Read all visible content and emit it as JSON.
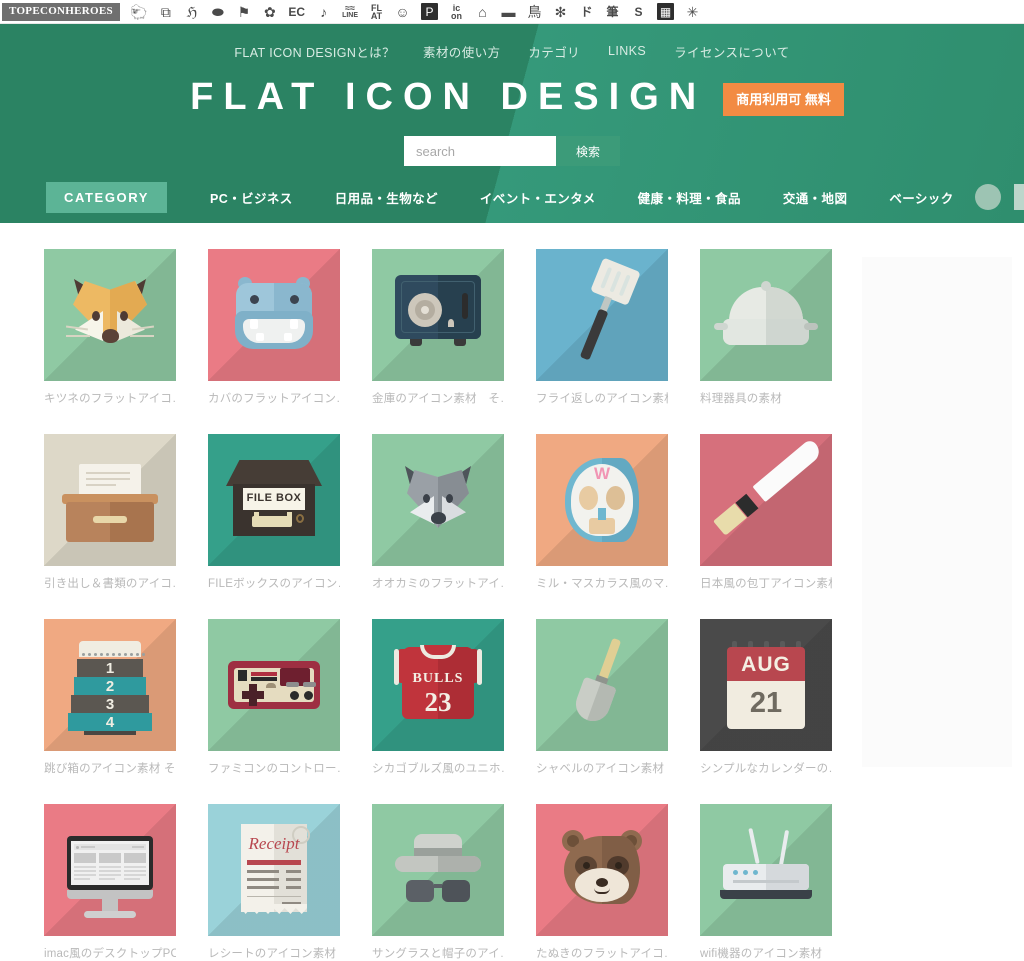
{
  "topbar": {
    "logo": "TOPECONHEROES",
    "icons": [
      {
        "name": "sheep-icon",
        "glyph": "ὁ1"
      },
      {
        "name": "copy-icon",
        "glyph": "⧉"
      },
      {
        "name": "person-icon",
        "glyph": "ေ2"
      },
      {
        "name": "speech-bubble-icon",
        "glyph": "⬬"
      },
      {
        "name": "flag-icon",
        "glyph": "⚑"
      },
      {
        "name": "flower-icon",
        "glyph": "✿"
      },
      {
        "name": "ec-icon",
        "glyph": "EC"
      },
      {
        "name": "music-note-icon",
        "glyph": "♪"
      },
      {
        "name": "line-icon",
        "glyph": "LINE"
      },
      {
        "name": "flat-icon",
        "glyph": "FL AT"
      },
      {
        "name": "smiley-icon",
        "glyph": "☺"
      },
      {
        "name": "parking-icon",
        "glyph": "P"
      },
      {
        "name": "ic-on-icon",
        "glyph": "ic on"
      },
      {
        "name": "building-icon",
        "glyph": "⌂"
      },
      {
        "name": "sofa-icon",
        "glyph": "▬"
      },
      {
        "name": "bird-icon",
        "glyph": "鳥"
      },
      {
        "name": "gear-flower-icon",
        "glyph": "✻"
      },
      {
        "name": "katakana-do-icon",
        "glyph": "ド"
      },
      {
        "name": "brush-icon",
        "glyph": "筆"
      },
      {
        "name": "s-plus-icon",
        "glyph": "S"
      },
      {
        "name": "grid-icon",
        "glyph": "░"
      },
      {
        "name": "sparkle-icon",
        "glyph": "✳"
      }
    ]
  },
  "header": {
    "global_nav": [
      {
        "label": "FLAT ICON DESIGNとは？"
      },
      {
        "label": "素材の使い方"
      },
      {
        "label": "カテゴリ"
      },
      {
        "label": "LINKS"
      },
      {
        "label": "ライセンスについて"
      }
    ],
    "site_title": "FLAT ICON DESIGN",
    "free_badge": "商用利用可 無料",
    "search": {
      "placeholder": "search",
      "value": "",
      "button_label": "検索"
    },
    "category_bar": {
      "pill_label": "CATEGORY",
      "items": [
        {
          "label": "PC・ビジネス"
        },
        {
          "label": "日用品・生物など"
        },
        {
          "label": "イベント・エンタメ"
        },
        {
          "label": "健康・料理・食品"
        },
        {
          "label": "交通・地図"
        },
        {
          "label": "ベーシック"
        }
      ],
      "shapes": [
        {
          "name": "circle-shape-filter"
        },
        {
          "name": "square-shape-filter"
        },
        {
          "name": "color-wheel-filter"
        }
      ]
    }
  },
  "colors": {
    "header_green": "#2e8b68",
    "accent_orange": "#f28b43",
    "pill_green": "#5cb496",
    "caption_gray": "#b9b9b9"
  },
  "grid": {
    "items": [
      {
        "caption": "キツネのフラットアイコ…",
        "icon": "fox-icon",
        "bg": "#8fc9a3"
      },
      {
        "caption": "カバのフラットアイコン…",
        "icon": "hippo-icon",
        "bg": "#ea7b85"
      },
      {
        "caption": "金庫のアイコン素材　そ…",
        "icon": "safe-icon",
        "bg": "#8fc9a3"
      },
      {
        "caption": "フライ返しのアイコン素材",
        "icon": "spatula-icon",
        "bg": "#6ab3cd"
      },
      {
        "caption": "料理器具の素材",
        "icon": "cookware-icon",
        "bg": "#8fc9a3"
      },
      {
        "caption": "引き出し＆書類のアイコ…",
        "icon": "drawer-icon",
        "bg": "#ddd8c8"
      },
      {
        "caption": "FILEボックスのアイコン…",
        "icon": "file-box-icon",
        "bg": "#35a08a"
      },
      {
        "caption": "オオカミのフラットアイ…",
        "icon": "wolf-icon",
        "bg": "#8fc9a3"
      },
      {
        "caption": "ミル・マスカラス風のマ…",
        "icon": "lucha-mask-icon",
        "bg": "#f0a982"
      },
      {
        "caption": "日本風の包丁アイコン素材",
        "icon": "knife-icon",
        "bg": "#d6707c"
      },
      {
        "caption": "跳び箱のアイコン素材 そ…",
        "icon": "vaulting-box-icon",
        "bg": "#f0a982"
      },
      {
        "caption": "ファミコンのコントロー…",
        "icon": "famicom-controller-icon",
        "bg": "#8fc9a3"
      },
      {
        "caption": "シカゴブルズ風のユニホ…",
        "icon": "basketball-jersey-icon",
        "bg": "#35a08a"
      },
      {
        "caption": "シャベルのアイコン素材",
        "icon": "shovel-icon",
        "bg": "#8fc9a3"
      },
      {
        "caption": "シンプルなカレンダーの…",
        "icon": "calendar-icon",
        "bg": "#4a4a4a"
      },
      {
        "caption": "imac風のデスクトップPC",
        "icon": "imac-icon",
        "bg": "#ea7b85"
      },
      {
        "caption": "レシートのアイコン素材",
        "icon": "receipt-icon",
        "bg": "#9ad2d9"
      },
      {
        "caption": "サングラスと帽子のアイ…",
        "icon": "sunglasses-hat-icon",
        "bg": "#8fc9a3"
      },
      {
        "caption": "たぬきのフラットアイコ…",
        "icon": "tanuki-icon",
        "bg": "#ea7b85"
      },
      {
        "caption": "wifi機器のアイコン素材",
        "icon": "wifi-router-icon",
        "bg": "#8fc9a3"
      }
    ]
  }
}
